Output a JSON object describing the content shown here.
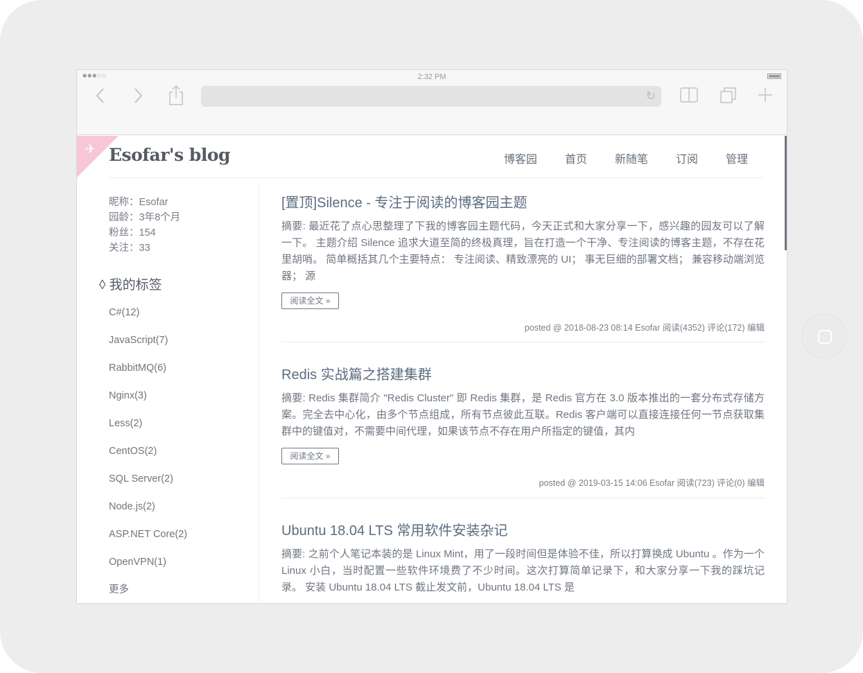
{
  "status": {
    "time": "2:32 PM",
    "signal": "●●●○○"
  },
  "browser": {
    "back_icon": "chevron-left-icon",
    "forward_icon": "chevron-right-icon",
    "share_icon": "share-icon",
    "reload_icon": "reload-icon",
    "bookmarks_icon": "book-icon",
    "tabs_icon": "tabs-icon",
    "new_tab_icon": "plus-icon"
  },
  "blog": {
    "title": "Esofar's blog",
    "nav": [
      "博客园",
      "首页",
      "新随笔",
      "订阅",
      "管理"
    ],
    "accent_color": "#f7c7d7"
  },
  "profile": {
    "nickname": "昵称：Esofar",
    "age": "园龄：3年8个月",
    "fans": "粉丝：154",
    "follows": "关注：33"
  },
  "tags": {
    "title": "◊ 我的标签",
    "items": [
      "C#(12)",
      "JavaScript(7)",
      "RabbitMQ(6)",
      "Nginx(3)",
      "Less(2)",
      "CentOS(2)",
      "SQL Server(2)",
      "Node.js(2)",
      "ASP.NET Core(2)",
      "OpenVPN(1)",
      "更多"
    ]
  },
  "posts": [
    {
      "title": "[置顶]Silence - 专注于阅读的博客园主题",
      "summary": "摘要: 最近花了点心思整理了下我的博客园主题代码，今天正式和大家分享一下，感兴趣的园友可以了解一下。 主题介绍 Silence 追求大道至简的终极真理，旨在打造一个干净、专注阅读的博客主题，不存在花里胡哨。 简单概括其几个主要特点： 专注阅读、精致漂亮的 UI； 事无巨细的部署文档； 兼容移动端浏览器； 源",
      "read_more": "阅读全文 »",
      "meta": "posted @ 2018-08-23 08:14 Esofar 阅读(4352) 评论(172) 编辑"
    },
    {
      "title": "Redis 实战篇之搭建集群",
      "summary": "摘要: Redis 集群简介 \"Redis Cluster\" 即 Redis 集群，是 Redis 官方在 3.0 版本推出的一套分布式存储方案。完全去中心化，由多个节点组成，所有节点彼此互联。Redis 客户端可以直接连接任何一节点获取集群中的键值对，不需要中间代理，如果该节点不存在用户所指定的键值，其内",
      "read_more": "阅读全文 »",
      "meta": "posted @ 2019-03-15 14:06 Esofar 阅读(723) 评论(0) 编辑"
    },
    {
      "title": "Ubuntu 18.04 LTS 常用软件安装杂记",
      "summary": "摘要: 之前个人笔记本装的是 Linux Mint，用了一段时间但是体验不佳，所以打算换成 Ubuntu 。作为一个 Linux 小白，当时配置一些软件环境费了不少时间。这次打算简单记录下，和大家分享一下我的踩坑记录。 安装 Ubuntu 18.04 LTS 截止发文前，Ubuntu 18.04 LTS 是"
    }
  ]
}
